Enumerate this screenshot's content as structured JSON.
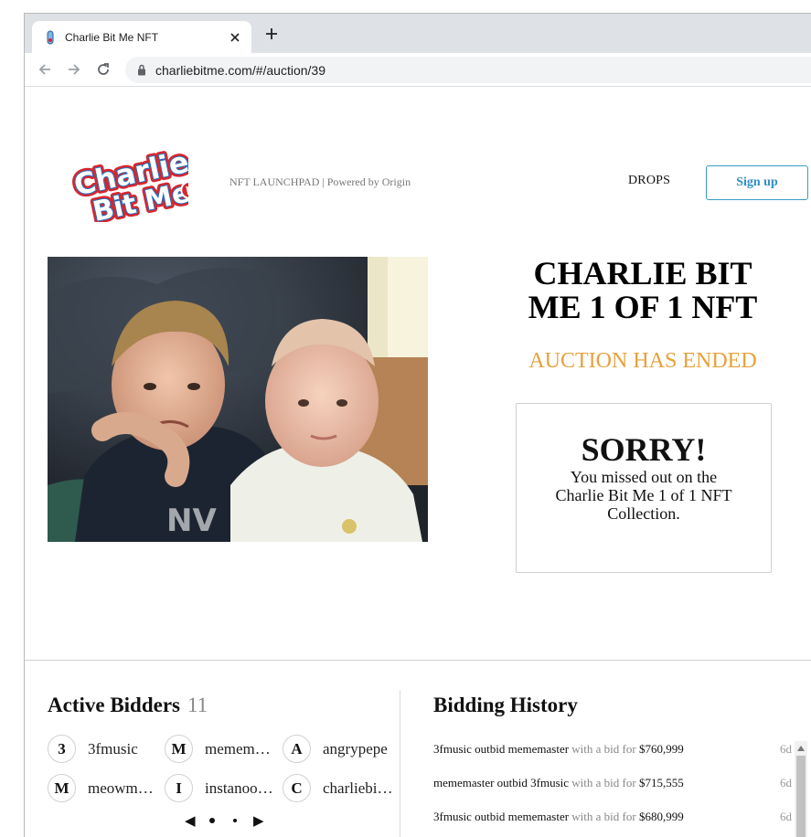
{
  "browser": {
    "tab_title": "Charlie Bit Me NFT",
    "url": "charliebitme.com/#/auction/39",
    "favicon": "charlie-bit-me-favicon",
    "icons": {
      "back": "arrow-left-icon",
      "forward": "arrow-right-icon",
      "reload": "reload-icon",
      "lock": "lock-icon",
      "close": "close-icon",
      "new_tab": "plus-icon"
    }
  },
  "header": {
    "logo_text_line1": "Charlie",
    "logo_text_line2": "Bit Me",
    "launchpad_text": "NFT LAUNCHPAD | Powered by Origin",
    "nav_drops": "DROPS",
    "signup_label": "Sign up"
  },
  "auction": {
    "title": "CHARLIE BIT ME 1 OF 1 NFT",
    "status": "AUCTION HAS ENDED",
    "status_color": "#e8a13a",
    "card_title": "SORRY!",
    "card_message": "You missed out on the Charlie Bit Me 1 of 1 NFT Collection."
  },
  "bidders": {
    "title": "Active Bidders",
    "count": "11",
    "list": [
      {
        "initial": "3",
        "name": "3fmusic"
      },
      {
        "initial": "M",
        "name": "mememaster"
      },
      {
        "initial": "A",
        "name": "angrypepe"
      },
      {
        "initial": "M",
        "name": "meowmeow"
      },
      {
        "initial": "I",
        "name": "instanoodles"
      },
      {
        "initial": "C",
        "name": "charliebitme"
      }
    ],
    "pager": {
      "prev": "◀",
      "next": "▶",
      "page_count": 2,
      "current_page": 1
    }
  },
  "history": {
    "title": "Bidding History",
    "rows": [
      {
        "bidder": "3fmusic",
        "verb": "outbid",
        "outbid": "mememaster",
        "phrase": "with a bid for",
        "amount": "$760,999",
        "time": "6d"
      },
      {
        "bidder": "mememaster",
        "verb": "outbid",
        "outbid": "3fmusic",
        "phrase": "with a bid for",
        "amount": "$715,555",
        "time": "6d"
      },
      {
        "bidder": "3fmusic",
        "verb": "outbid",
        "outbid": "mememaster",
        "phrase": "with a bid for",
        "amount": "$680,999",
        "time": "6d"
      }
    ]
  },
  "colors": {
    "accent_blue": "#2f8ec4",
    "status_orange": "#e8a13a",
    "logo_red": "#d7262d",
    "logo_blue": "#1e74c8"
  }
}
